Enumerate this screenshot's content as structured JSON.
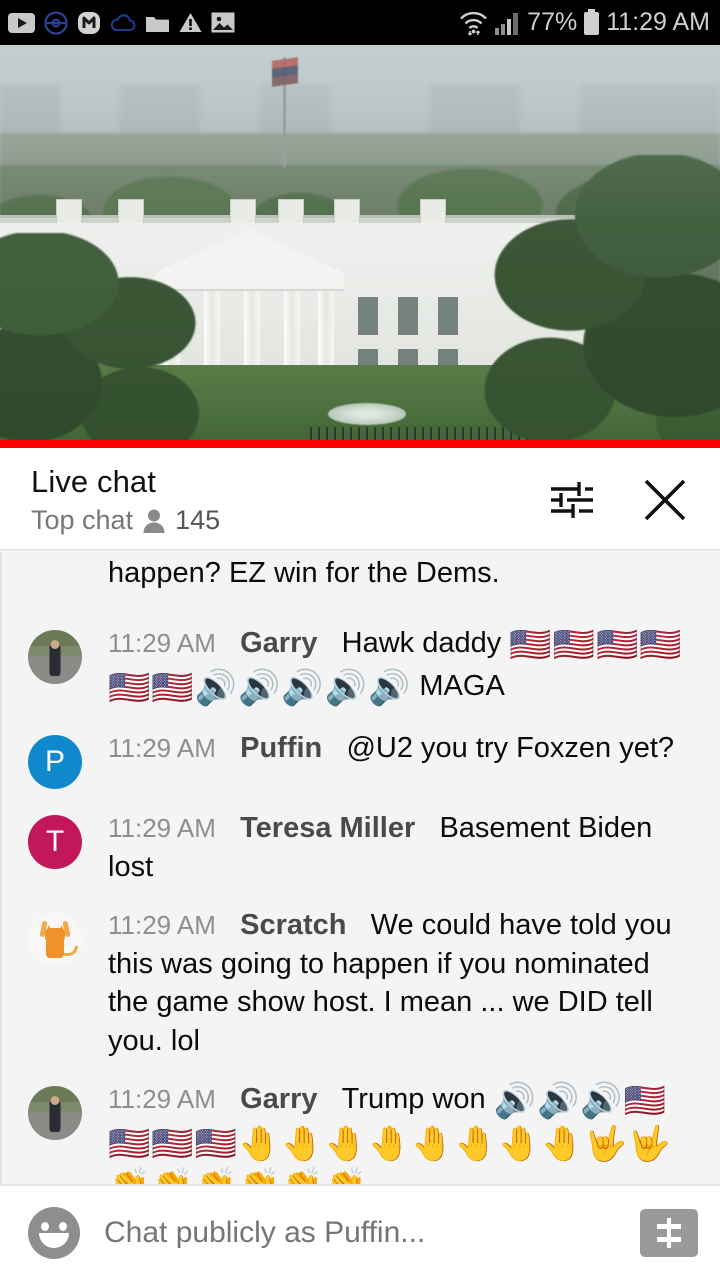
{
  "status_bar": {
    "icons": [
      "youtube-icon",
      "pokeball-icon",
      "m-app-icon",
      "cloud-icon",
      "folder-icon",
      "warning-icon",
      "image-icon"
    ],
    "wifi_icon": "wifi-icon",
    "signal_icon": "cellular-signal-icon",
    "battery_percent": "77%",
    "battery_icon": "battery-icon",
    "clock": "11:29 AM"
  },
  "video": {
    "description": "White House live stream",
    "progress_color": "#ff0000",
    "progress_percent": 100
  },
  "chat_header": {
    "title": "Live chat",
    "mode": "Top chat",
    "viewer_icon": "person-icon",
    "viewer_count": "145",
    "settings_icon": "tune-sliders-icon",
    "close_icon": "close-icon"
  },
  "messages": [
    {
      "id": "partial-top",
      "partial": true,
      "avatar": {
        "type": "none"
      },
      "time": "",
      "author": "",
      "text": "happen? EZ win for the Dems."
    },
    {
      "id": "garry-1",
      "partial": false,
      "avatar": {
        "type": "photo",
        "alt": "garry-photo-avatar"
      },
      "time": "11:29 AM",
      "author": "Garry",
      "text": "Hawk daddy ",
      "emoji": "🇺🇸🇺🇸🇺🇸🇺🇸🇺🇸🇺🇸🔊🔊🔊🔊🔊",
      "text_after": " MAGA"
    },
    {
      "id": "puffin-1",
      "partial": false,
      "avatar": {
        "type": "letter",
        "letter": "P",
        "color": "#1089cc"
      },
      "time": "11:29 AM",
      "author": "Puffin",
      "text": "@U2 you try Foxzen yet?"
    },
    {
      "id": "teresa-1",
      "partial": false,
      "avatar": {
        "type": "letter",
        "letter": "T",
        "color": "#c2185b"
      },
      "time": "11:29 AM",
      "author": "Teresa Miller",
      "text": "Basement Biden lost"
    },
    {
      "id": "scratch-1",
      "partial": false,
      "avatar": {
        "type": "cat",
        "alt": "scratch-cat-avatar"
      },
      "time": "11:29 AM",
      "author": "Scratch",
      "text": "We could have told you this was going to happen if you nominated the game show host. I mean ... we DID tell you. lol"
    },
    {
      "id": "garry-2",
      "partial": false,
      "avatar": {
        "type": "photo",
        "alt": "garry-photo-avatar"
      },
      "time": "11:29 AM",
      "author": "Garry",
      "text": "Trump won ",
      "emoji": "🔊🔊🔊🇺🇸🇺🇸🇺🇸🇺🇸🤚🤚🤚🤚🤚🤚🤚🤚🤟🤟👏👏👏👏👏👏",
      "text_after": ""
    }
  ],
  "composer": {
    "emoji_icon": "emoji-face-icon",
    "placeholder": "Chat publicly as Puffin...",
    "superchat_icon": "dollar-superchat-icon",
    "superchat_label": "$"
  },
  "colors": {
    "accent_red": "#ff0000",
    "chat_bg": "#f4f4f4",
    "header_bg": "#ffffff",
    "status_bg": "#000000"
  }
}
